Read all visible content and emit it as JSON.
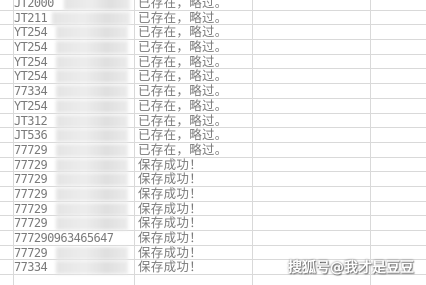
{
  "rows": [
    {
      "id": "JT2000",
      "status": "已存在，略过。"
    },
    {
      "id": "JT211",
      "status": "已存在，略过。"
    },
    {
      "id": "YT254",
      "status": "已存在，略过。"
    },
    {
      "id": "YT254",
      "status": "已存在，略过。"
    },
    {
      "id": "YT254",
      "status": "已存在，略过。"
    },
    {
      "id": "YT254",
      "status": "已存在，略过。"
    },
    {
      "id": "77334",
      "status": "已存在，略过。"
    },
    {
      "id": "YT254",
      "status": "已存在，略过。"
    },
    {
      "id": "JT312",
      "status": "已存在，略过。"
    },
    {
      "id": "JT536",
      "status": "已存在，略过。"
    },
    {
      "id": "77729",
      "status": "已存在，略过。"
    },
    {
      "id": "77729",
      "status": "保存成功！"
    },
    {
      "id": "77729",
      "status": "保存成功！"
    },
    {
      "id": "77729",
      "status": "保存成功！"
    },
    {
      "id": "77729",
      "status": "保存成功！"
    },
    {
      "id": "77729",
      "status": "保存成功！"
    },
    {
      "id": "777290963465647",
      "status": "保存成功！"
    },
    {
      "id": "77729",
      "status": "保存成功！"
    },
    {
      "id": "77334",
      "status": "保存成功！"
    }
  ],
  "watermark": "搜狐号@我才是豆豆"
}
